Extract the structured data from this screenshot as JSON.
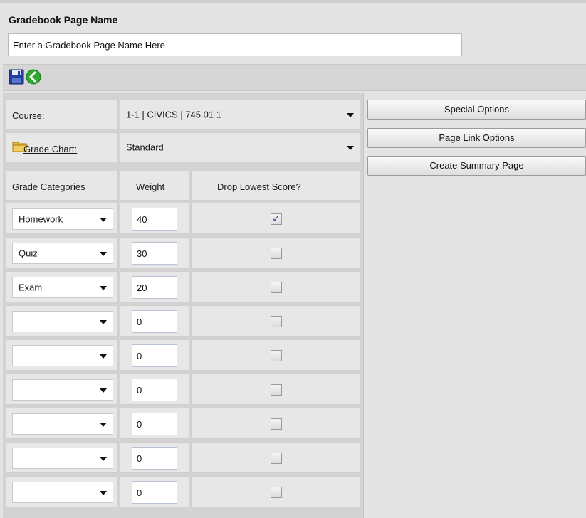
{
  "page_title_label": "Gradebook Page Name",
  "page_name_input": {
    "placeholder": "Enter a Gradebook Page Name Here",
    "value": ""
  },
  "toolbar": {
    "save_icon": "floppy-disk",
    "back_icon": "green-back-arrow"
  },
  "course": {
    "label": "Course:",
    "value": "1-1 | CIVICS | 745 01 1"
  },
  "grade_chart": {
    "label": "Grade Chart:",
    "value": "Standard",
    "icon": "folder"
  },
  "table_headers": {
    "categories": "Grade Categories",
    "weight": "Weight",
    "drop_lowest": "Drop Lowest Score?"
  },
  "rows": [
    {
      "category": "Homework",
      "weight": "40",
      "drop_lowest": true
    },
    {
      "category": "Quiz",
      "weight": "30",
      "drop_lowest": false
    },
    {
      "category": "Exam",
      "weight": "20",
      "drop_lowest": false
    },
    {
      "category": "",
      "weight": "0",
      "drop_lowest": false
    },
    {
      "category": "",
      "weight": "0",
      "drop_lowest": false
    },
    {
      "category": "",
      "weight": "0",
      "drop_lowest": false
    },
    {
      "category": "",
      "weight": "0",
      "drop_lowest": false
    },
    {
      "category": "",
      "weight": "0",
      "drop_lowest": false
    },
    {
      "category": "",
      "weight": "0",
      "drop_lowest": false
    }
  ],
  "buttons": {
    "special_options": "Special Options",
    "page_link_options": "Page Link Options",
    "create_summary_page": "Create Summary Page"
  },
  "colors": {
    "save_icon": "#1f3f9e",
    "back_icon": "#2ea82e",
    "checkmark": "#3a4fa8"
  }
}
